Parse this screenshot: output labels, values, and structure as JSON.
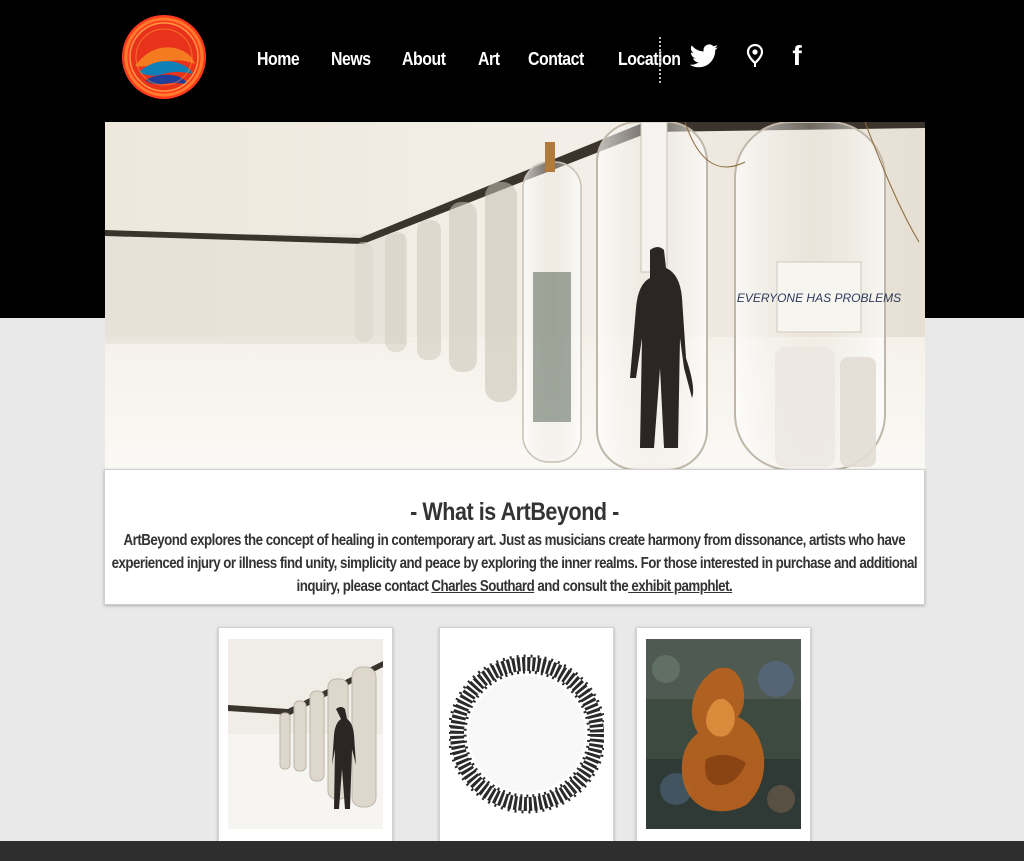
{
  "nav": {
    "items": [
      {
        "label": "Home"
      },
      {
        "label": "News"
      },
      {
        "label": "About"
      },
      {
        "label": "Art"
      },
      {
        "label": "Contact"
      },
      {
        "label": "Location"
      }
    ]
  },
  "social": {
    "icons": [
      "twitter-icon",
      "location-pin-icon",
      "facebook-icon"
    ],
    "facebook_glyph": "f"
  },
  "hero": {
    "image": "hanging-glass-bottles-installation",
    "bottle_label": "EVERYONE HAS PROBLEMS"
  },
  "about": {
    "heading": "- What is ArtBeyond -",
    "text_before_link": "ArtBeyond explores the concept of healing in contemporary art. Just as musicians create harmony from dissonance, artists who have experienced injury or illness find unity, simplicity and peace by exploring the inner realms.  For those interested in purchase and additional inquiry, please contact ",
    "contact_link": "Charles Southard",
    "text_middle": " and consult the",
    "pamphlet_link": " exhibit pamphlet."
  },
  "thumbnails": [
    {
      "subject": "bottles-installation-thumbnail"
    },
    {
      "subject": "circular-wreath-sculpture-thumbnail"
    },
    {
      "subject": "abstract-orange-figure-thumbnail"
    }
  ],
  "colors": {
    "header_bg": "#000000",
    "page_bg": "#e9e9e9",
    "footer_bar": "#2e2e2e",
    "text": "#333333",
    "logo_red": "#e8321c",
    "logo_blue": "#1f3f9a",
    "logo_orange": "#f47b20"
  }
}
